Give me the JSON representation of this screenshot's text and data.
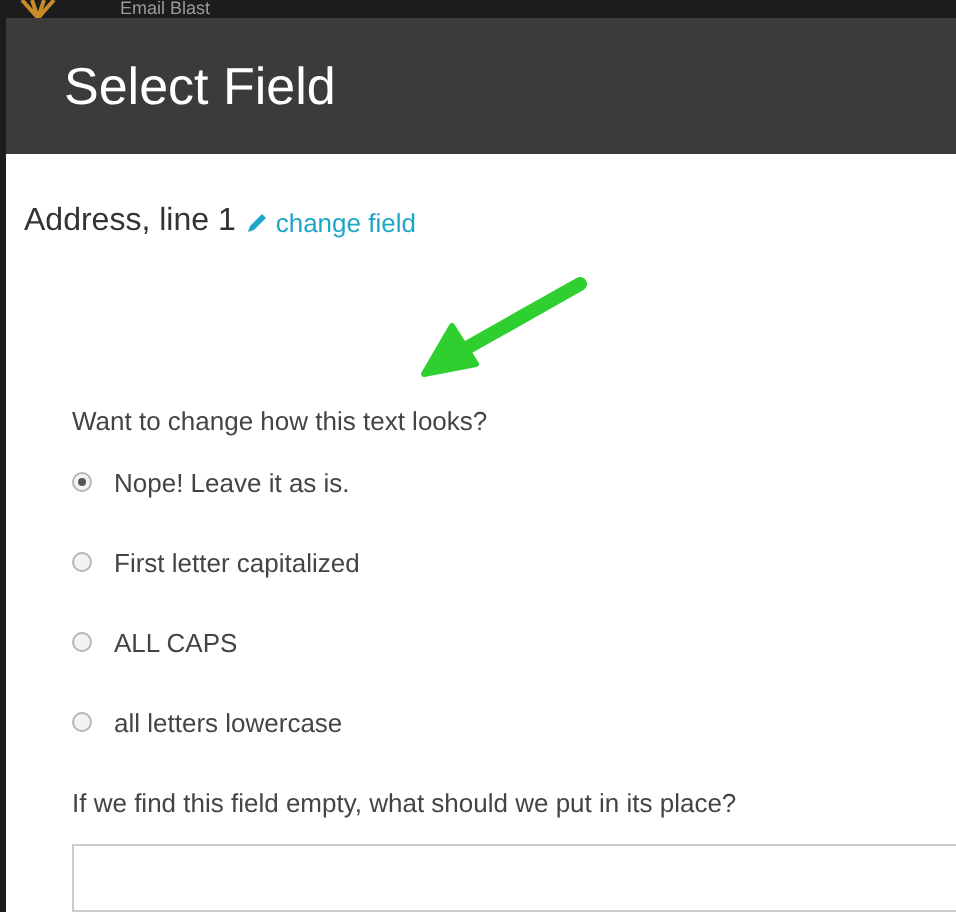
{
  "background": {
    "title": "Email Blast"
  },
  "dialog": {
    "title": "Select Field",
    "field": {
      "name": "Address, line 1",
      "change_link": "change field"
    },
    "format_question": "Want to change how this text looks?",
    "options": [
      {
        "label": "Nope! Leave it as is.",
        "selected": true
      },
      {
        "label": "First letter capitalized",
        "selected": false
      },
      {
        "label": "ALL CAPS",
        "selected": false
      },
      {
        "label": "all letters lowercase",
        "selected": false
      }
    ],
    "empty_question": "If we find this field empty, what should we put in its place?"
  }
}
